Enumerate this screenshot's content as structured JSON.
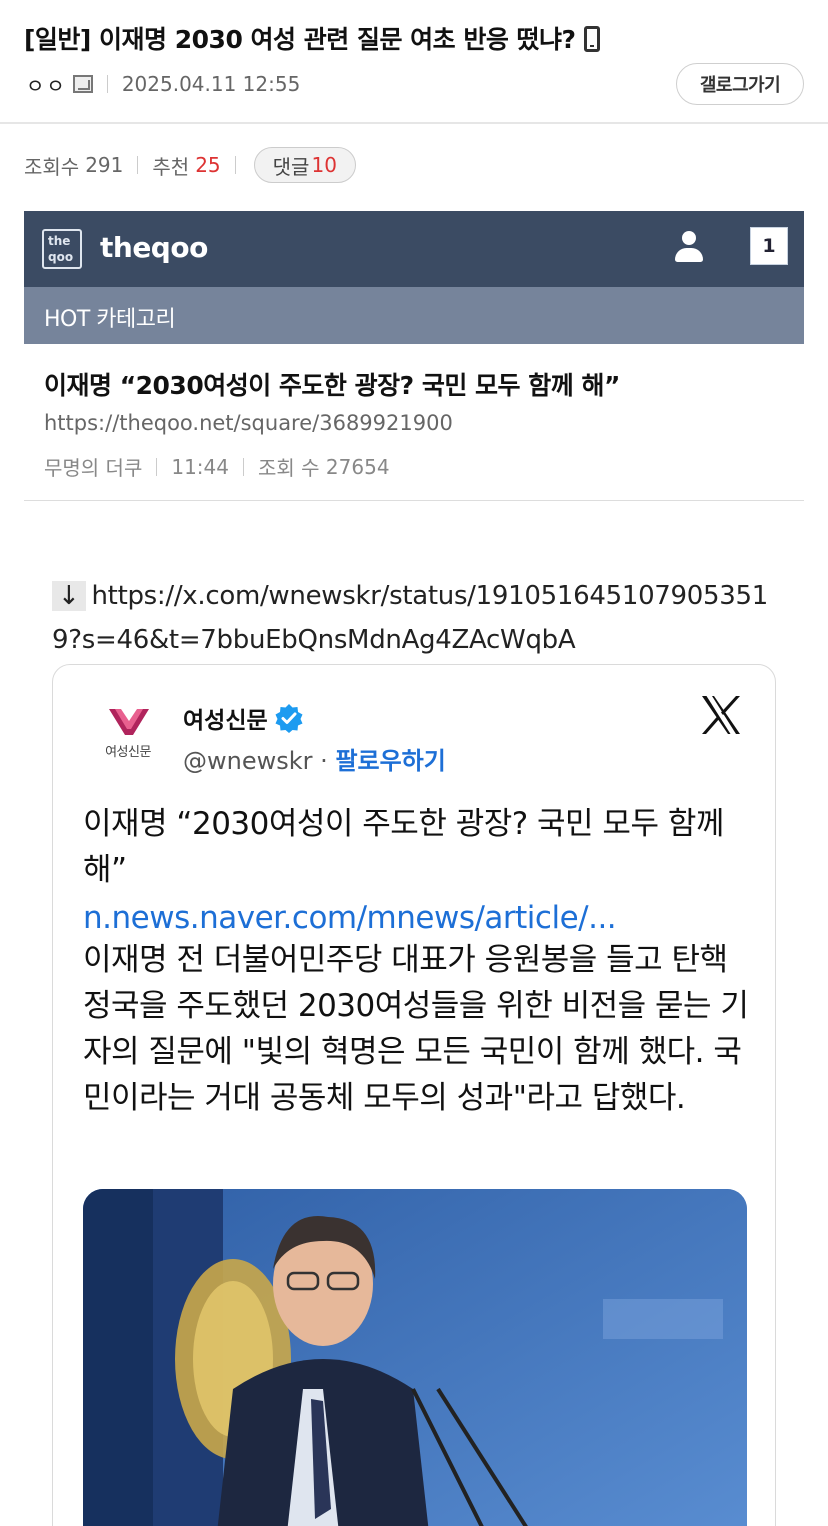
{
  "post": {
    "title": "[일반] 이재명 2030 여성 관련 질문 여초 반응 떴냐?",
    "author": "ㅇㅇ",
    "datetime": "2025.04.11 12:55",
    "gallery_button": "갤로그가기"
  },
  "stats": {
    "views_label": "조회수",
    "views": "291",
    "recommend_label": "추천",
    "recommend": "25",
    "comments_label": "댓글",
    "comments": "10"
  },
  "theqoo": {
    "brand": "theqoo",
    "logo_top": "the",
    "logo_bottom": "qoo",
    "notif_count": "1",
    "category": "HOT 카테고리",
    "article_title": "이재명 “2030여성이 주도한 광장? 국민 모두 함께 해”",
    "article_url": "https://theqoo.net/square/3689921900",
    "article_author": "무명의 더쿠",
    "article_time": "11:44",
    "article_views_label": "조회 수",
    "article_views": "27654"
  },
  "link": {
    "arrow": "↓",
    "url": "https://x.com/wnewskr/status/1910516451079053519?s=46&t=7bbuEbQnsMdnAg4ZAcWqbA"
  },
  "tweet": {
    "logo_text": "여성신문",
    "name": "여성신문",
    "handle": "@wnewskr",
    "dot": "·",
    "follow": "팔로우하기",
    "headline": "이재명 “2030여성이 주도한 광장? 국민 모두 함께 해”",
    "link": "n.news.naver.com/mnews/article/...",
    "body": "이재명 전 더불어민주당 대표가 응원봉을 들고 탄핵 정국을 주도했던 2030여성들을 위한 비전을 묻는 기자의 질문에 \"빛의 혁명은 모든 국민이 함께 했다. 국민이라는 거대 공동체 모두의 성과\"라고 답했다."
  },
  "colors": {
    "theqoo_bar": "#3b4b63",
    "hot_bar": "#76849b",
    "link_blue": "#1d6fd6",
    "highlight_red": "#d33333"
  }
}
